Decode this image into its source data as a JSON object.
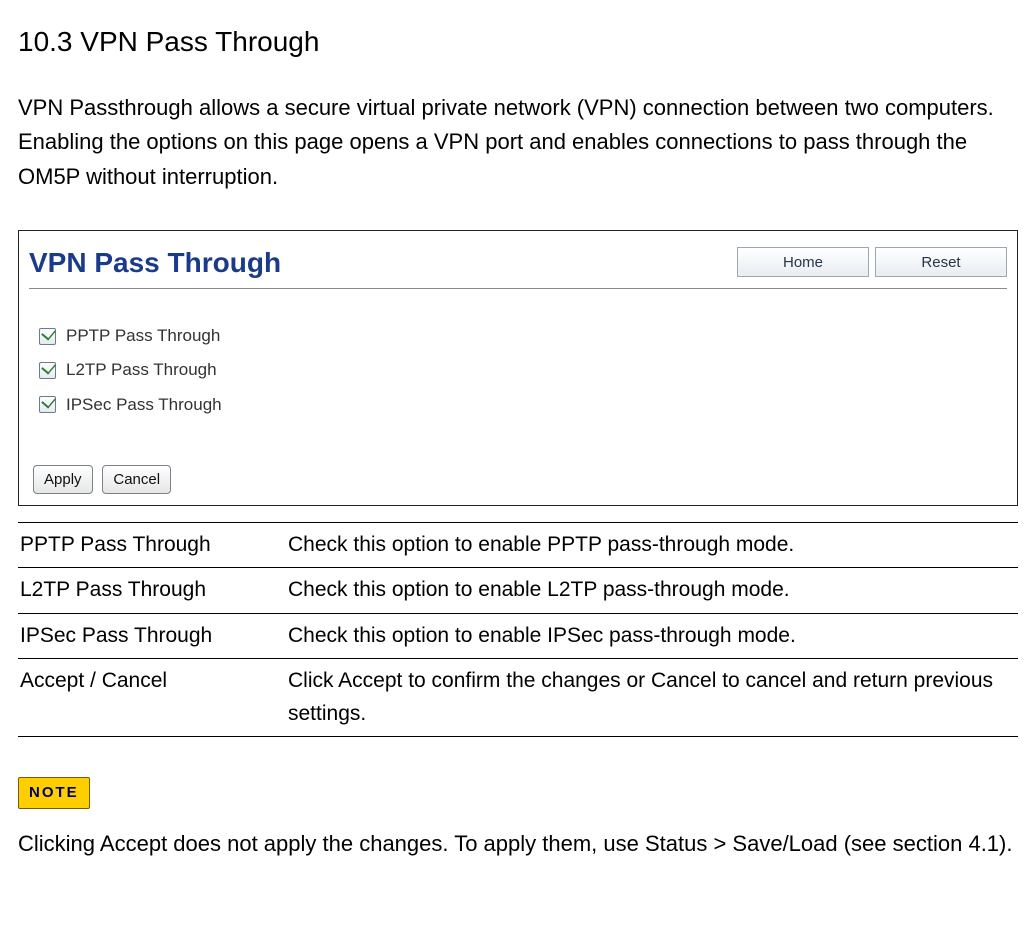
{
  "section": {
    "title": "10.3 VPN Pass Through",
    "intro": "VPN Passthrough allows a secure virtual private network (VPN) connection between two computers. Enabling the options on this page opens a VPN port and enables connections to pass through the OM5P without interruption."
  },
  "panel": {
    "title": "VPN Pass Through",
    "home_label": "Home",
    "reset_label": "Reset",
    "options": [
      {
        "label": "PPTP Pass Through"
      },
      {
        "label": "L2TP Pass Through"
      },
      {
        "label": "IPSec Pass Through"
      }
    ],
    "apply_label": "Apply",
    "cancel_label": "Cancel"
  },
  "defs": [
    {
      "name": "PPTP Pass Through",
      "desc": "Check this option to enable PPTP pass-through mode."
    },
    {
      "name": "L2TP Pass Through",
      "desc": "Check this option to enable L2TP pass-through mode."
    },
    {
      "name": "IPSec Pass Through",
      "desc": "Check this option to enable IPSec pass-through mode."
    },
    {
      "name": "Accept / Cancel",
      "desc": "Click Accept to confirm the changes or Cancel to cancel and return previous settings."
    }
  ],
  "note": {
    "badge": "NOTE",
    "text": "Clicking Accept does not apply the changes. To apply them, use Status > Save/Load (see section 4.1)."
  }
}
